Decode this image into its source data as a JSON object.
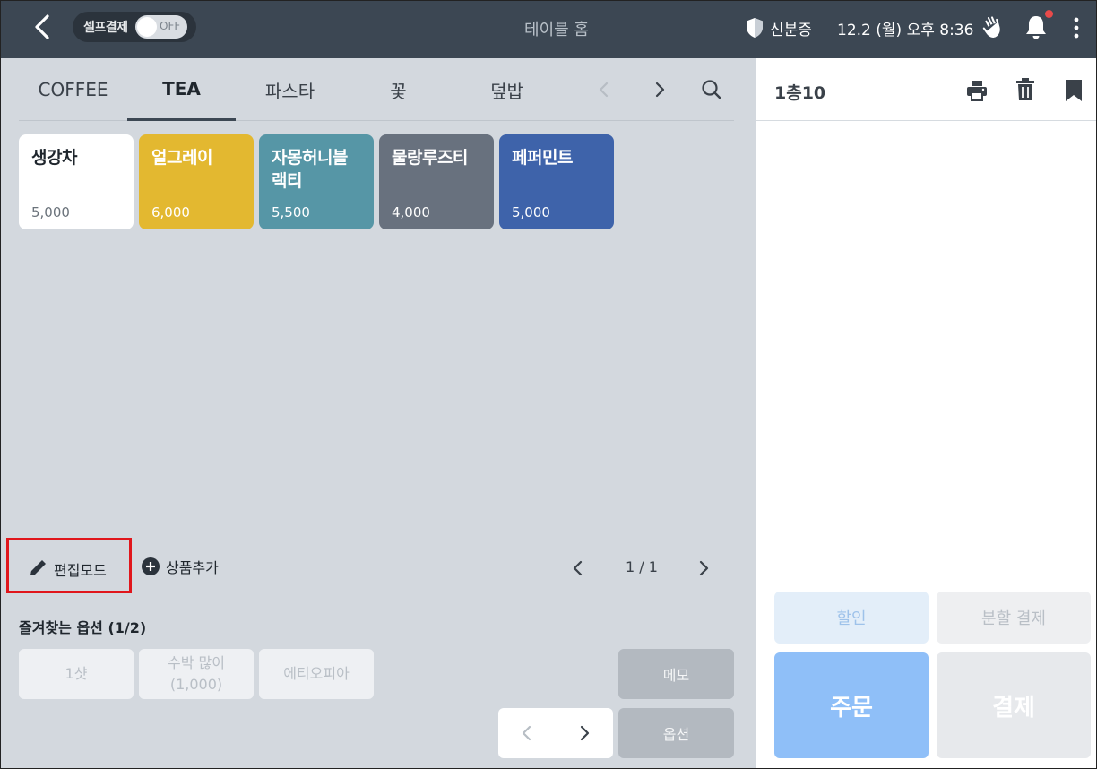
{
  "topbar": {
    "self_pay_label": "셀프결제",
    "toggle_state": "OFF",
    "title": "테이블 홈",
    "id_label": "신분증",
    "datetime": "12.2 (월) 오후 8:36",
    "notification_dot_color": "#e84a4a"
  },
  "tabs": [
    {
      "label": "COFFEE",
      "active": false
    },
    {
      "label": "TEA",
      "active": true
    },
    {
      "label": "파스타",
      "active": false
    },
    {
      "label": "꽃",
      "active": false
    },
    {
      "label": "덮밥",
      "active": false
    }
  ],
  "products": [
    {
      "name": "생강차",
      "price": "5,000",
      "color": "#ffffff",
      "text_color": "#1f262d",
      "price_color": "#6b737b"
    },
    {
      "name": "얼그레이",
      "price": "6,000",
      "color": "#e3b830",
      "text_color": "#ffffff",
      "price_color": "#ffffff"
    },
    {
      "name": "자몽허니블랙티",
      "price": "5,500",
      "color": "#5696a6",
      "text_color": "#ffffff",
      "price_color": "#ffffff"
    },
    {
      "name": "물랑루즈티",
      "price": "4,000",
      "color": "#68717e",
      "text_color": "#ffffff",
      "price_color": "#ffffff"
    },
    {
      "name": "페퍼민트",
      "price": "5,000",
      "color": "#3e63aa",
      "text_color": "#ffffff",
      "price_color": "#ffffff"
    }
  ],
  "toolbar": {
    "edit_mode_label": "편집모드",
    "add_product_label": "상품추가",
    "page_indicator": "1 / 1"
  },
  "favorites": {
    "title": "즐겨찾는 옵션 (1/2)",
    "options": [
      {
        "label": "1샷",
        "sub": ""
      },
      {
        "label": "수박 많이",
        "sub": "(1,000)"
      },
      {
        "label": "에티오피아",
        "sub": ""
      }
    ],
    "memo_label": "메모",
    "option_label": "옵션"
  },
  "order_panel": {
    "table_name": "1층10",
    "discount_label": "할인",
    "split_pay_label": "분할 결제",
    "order_label": "주문",
    "pay_label": "결제",
    "accent_color": "#8fbff8"
  }
}
